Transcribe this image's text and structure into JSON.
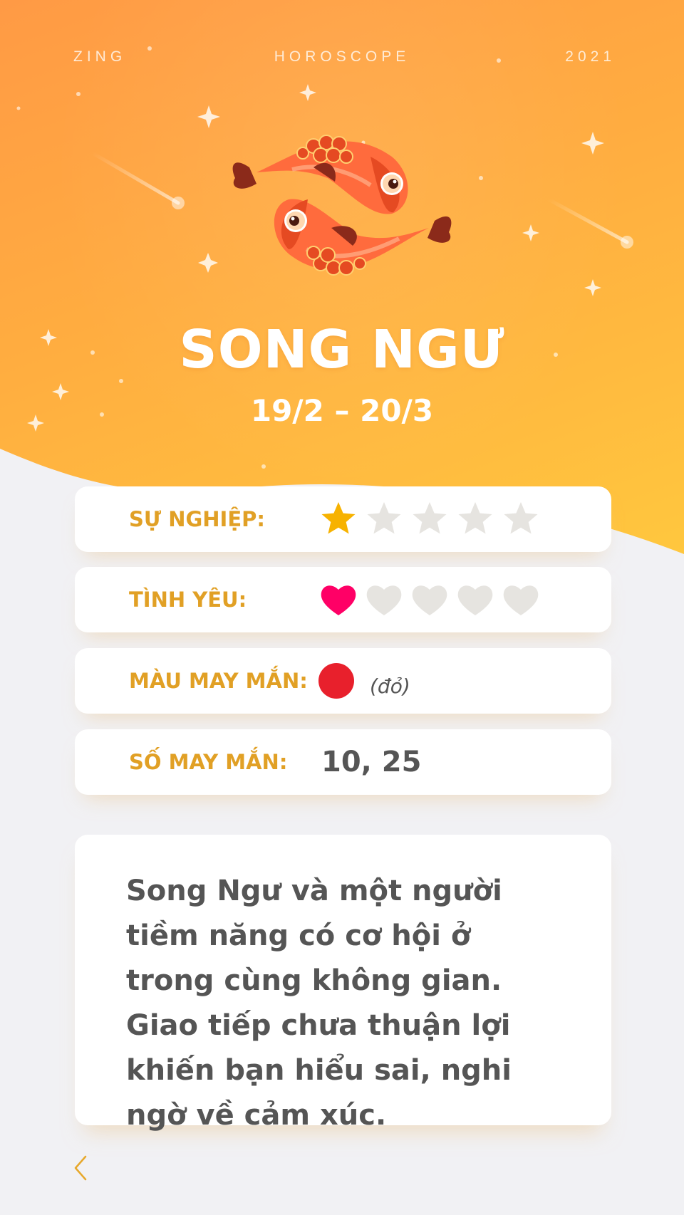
{
  "header": {
    "left": "ZING",
    "center": "HOROSCOPE",
    "right": "2021"
  },
  "sign": {
    "name": "SONG NGƯ",
    "dates": "19/2 – 20/3",
    "icon": "pisces-fish-icon"
  },
  "ratings": {
    "career": {
      "label": "SỰ NGHIỆP:",
      "score": 1,
      "max": 5,
      "icon": "star-icon",
      "active_color": "#f7b200"
    },
    "love": {
      "label": "TÌNH YÊU:",
      "score": 1,
      "max": 5,
      "icon": "heart-icon",
      "active_color": "#ff0066"
    }
  },
  "lucky_color": {
    "label": "MÀU MAY MẮN:",
    "color": "#e8202c",
    "name": "(đỏ)"
  },
  "lucky_number": {
    "label": "SỐ MAY MẮN:",
    "value": "10, 25"
  },
  "description": "Song Ngư và một người tiềm năng có cơ hội ở trong cùng không gian. Giao tiếp chưa thuận lợi khiến bạn hiểu sai, nghi ngờ về cảm xúc.",
  "nav": {
    "back_icon": "chevron-left-icon"
  },
  "colors": {
    "label": "#e1a025",
    "inactive": "#e6e4e0",
    "text": "#555555"
  }
}
